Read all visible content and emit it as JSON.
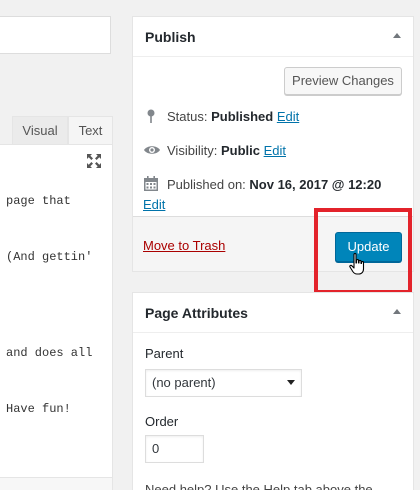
{
  "editor": {
    "tabs": {
      "visual": "Visual",
      "text": "Text"
    },
    "lines": [
      "page that",
      "(And gettin'",
      "and does all",
      "Have fun!"
    ]
  },
  "publish": {
    "title": "Publish",
    "preview_label": "Preview Changes",
    "status_label": "Status:",
    "status_value": "Published",
    "status_edit": "Edit",
    "visibility_label": "Visibility:",
    "visibility_value": "Public",
    "visibility_edit": "Edit",
    "published_label": "Published on:",
    "published_value": "Nov 16, 2017 @ 12:20",
    "published_edit": "Edit",
    "trash_label": "Move to Trash",
    "update_label": "Update"
  },
  "page_attributes": {
    "title": "Page Attributes",
    "parent_label": "Parent",
    "parent_value": "(no parent)",
    "order_label": "Order",
    "order_value": "0",
    "help_text": "Need help? Use the Help tab above the"
  },
  "colors": {
    "primary_button": "#0085ba",
    "link": "#0073aa",
    "trash": "#a00",
    "highlight": "#e3232b"
  }
}
